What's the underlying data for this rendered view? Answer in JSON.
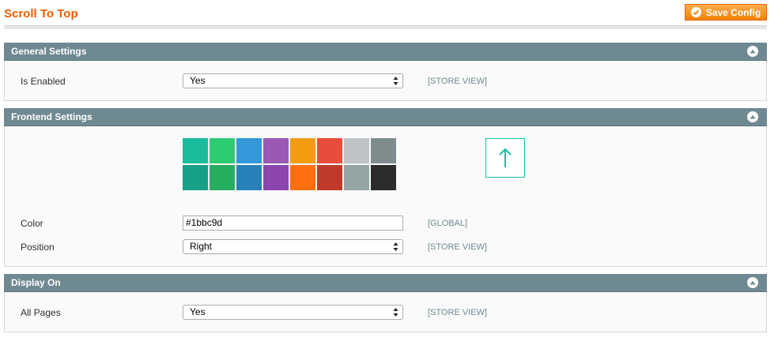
{
  "page": {
    "title": "Scroll To Top",
    "save_label": "Save Config"
  },
  "sections": {
    "general": {
      "title": "General Settings",
      "is_enabled": {
        "label": "Is Enabled",
        "value": "Yes",
        "scope": "[STORE VIEW]"
      }
    },
    "frontend": {
      "title": "Frontend Settings",
      "swatches": [
        "#1abc9c",
        "#2ecc71",
        "#3498db",
        "#9b59b6",
        "#f39c12",
        "#e74c3c",
        "#bdc3c7",
        "#7f8c8d",
        "#16a085",
        "#27ae60",
        "#2980b9",
        "#8e44ad",
        "#ff6f0f",
        "#c0392b",
        "#95a5a6",
        "#2c2c2c"
      ],
      "color": {
        "label": "Color",
        "value": "#1bbc9d",
        "scope": "[GLOBAL]"
      },
      "position": {
        "label": "Position",
        "value": "Right",
        "scope": "[STORE VIEW]"
      },
      "preview_icon": "arrow-up-icon"
    },
    "display": {
      "title": "Display On",
      "all_pages": {
        "label": "All Pages",
        "value": "Yes",
        "scope": "[STORE VIEW]"
      }
    }
  },
  "colors": {
    "accent": "#eb5e00",
    "header": "#6f8992",
    "selected_color": "#1bbc9d"
  }
}
